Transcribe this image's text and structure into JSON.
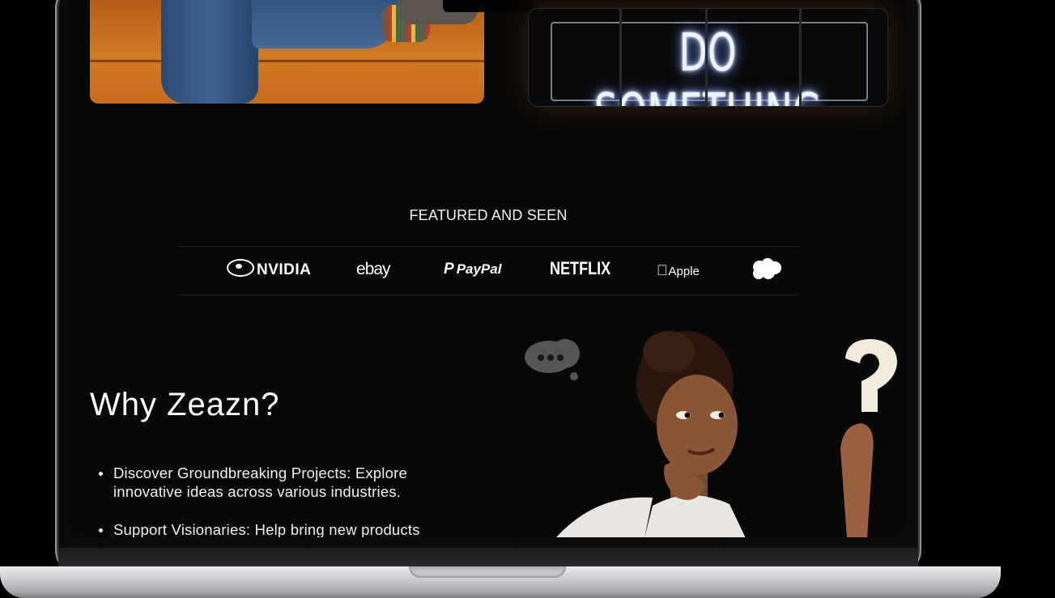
{
  "hero": {
    "neon_sign_text": "DO SOMETHING GREAT"
  },
  "featured": {
    "title": "FEATURED AND SEEN",
    "logos": [
      "NVIDIA",
      "ebay",
      "PayPal",
      "NETFLIX",
      "Apple",
      "salesforce"
    ]
  },
  "why": {
    "title": "Why Zeazn?",
    "items": [
      "Discover Groundbreaking Projects: Explore innovative ideas across various industries.",
      "Support Visionaries: Help bring new products"
    ]
  },
  "icons": {
    "thought_bubble": "thought-bubble-icon",
    "question_mark": "question-mark-icon",
    "apple": "apple-icon",
    "salesforce": "salesforce-cloud-icon"
  },
  "colors": {
    "page_bg": "#080808",
    "text": "#f2f2f2",
    "neon_glow": "#9fc0ff",
    "laptop_silver": "#cfd0d3"
  }
}
